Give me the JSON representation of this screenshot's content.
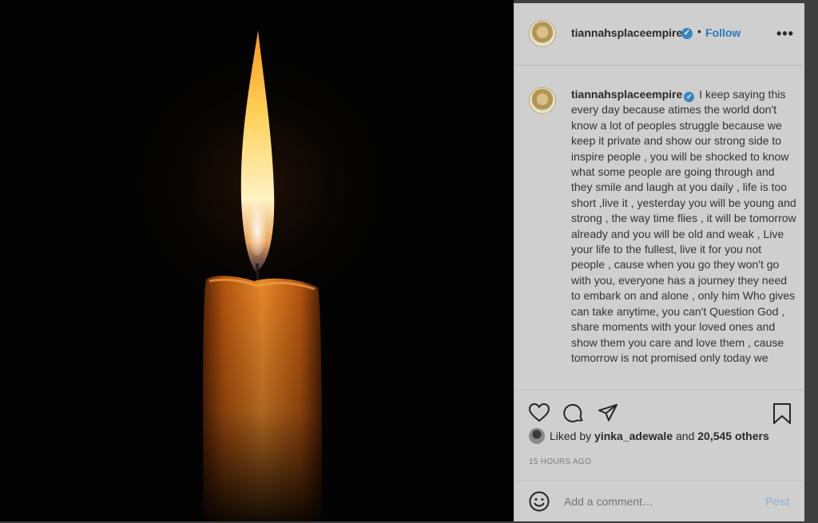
{
  "header": {
    "username": "tiannahsplaceempire",
    "verified_mark": "✓",
    "separator": "•",
    "follow_label": "Follow",
    "more_label": "•••"
  },
  "caption": {
    "username": "tiannahsplaceempire",
    "text": "I keep saying this every day because atimes the world don't know a lot of peoples struggle because we keep it private and show our strong side to inspire people , you will be shocked to know what some people are going through and they smile and laugh at you daily , life is too short ,live it , yesterday you will be young and strong , the way time flies , it will be tomorrow already and you will be old and weak , Live your life to the fullest, live it for you not people , cause when you go they won't go with you, everyone has a journey they need to embark on and alone , only him Who gives can take anytime, you can't Question God , share moments with your loved ones and show them you care and love them , cause tomorrow is not promised only today we"
  },
  "actions": {
    "like_icon": "heart-icon",
    "comment_icon": "comment-bubble-icon",
    "share_icon": "paper-plane-icon",
    "save_icon": "bookmark-icon"
  },
  "likes": {
    "prefix": "Liked by",
    "user": "yinka_adewale",
    "conjunction": "and",
    "others": "20,545 others"
  },
  "timestamp": "15 HOURS AGO",
  "comment": {
    "placeholder": "Add a comment…",
    "post_label": "Post",
    "emoji_icon": "smiley-icon"
  },
  "colors": {
    "accent": "#2e79bd",
    "verified": "#3a86c4",
    "panel_bg": "#cfcfcf",
    "image_bg": "#030303"
  }
}
